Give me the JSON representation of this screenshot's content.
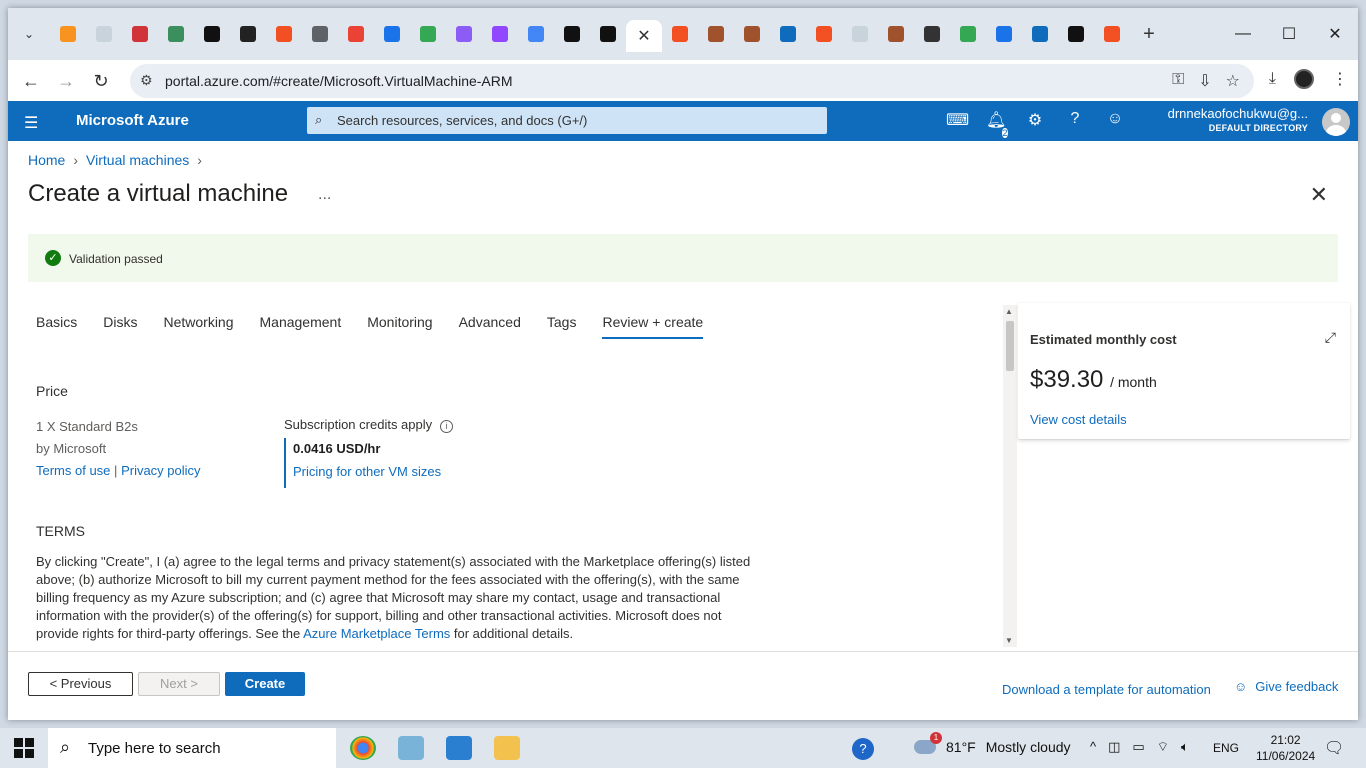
{
  "browser": {
    "url": "portal.azure.com/#create/Microsoft.VirtualMachine-ARM",
    "tab_favicons": [
      "#f7931e",
      "#c8d3dc",
      "#d13438",
      "#3a8f5c",
      "#111111",
      "#222222",
      "#f25022",
      "#5f6368",
      "#ea4335",
      "#1a73e8",
      "#34a853",
      "#8b5cf6",
      "#9146ff",
      "#4285f4",
      "#111111",
      "#111111",
      "#ffffff",
      "#f25022",
      "#a0522d",
      "#a0522d",
      "#0f6cbd",
      "#f25022",
      "#c8d3dc",
      "#a0522d",
      "#333333",
      "#34a853",
      "#1a73e8",
      "#0f6cbd",
      "#111111",
      "#f25022"
    ],
    "window_controls": {
      "minimize": "—",
      "maximize": "☐",
      "close": "✕"
    }
  },
  "azure": {
    "brand": "Microsoft Azure",
    "search_placeholder": "Search resources, services, and docs (G+/)",
    "notification_count": "2",
    "user_email": "drnnekaofochukwu@g...",
    "directory": "DEFAULT DIRECTORY"
  },
  "breadcrumb": {
    "home": "Home",
    "virtual_machines": "Virtual machines"
  },
  "page": {
    "title": "Create a virtual machine",
    "more": "...",
    "validation": "Validation passed"
  },
  "tabs": [
    "Basics",
    "Disks",
    "Networking",
    "Management",
    "Monitoring",
    "Advanced",
    "Tags",
    "Review + create"
  ],
  "price": {
    "heading": "Price",
    "sku": "1 X Standard B2s",
    "publisher": "by Microsoft",
    "terms_link": "Terms of use",
    "separator": "|",
    "privacy_link": "Privacy policy",
    "credits": "Subscription credits apply",
    "rate": "0.0416 USD/hr",
    "pricing_link": "Pricing for other VM sizes"
  },
  "terms": {
    "heading": "TERMS",
    "text_before": "By clicking \"Create\", I (a) agree to the legal terms and privacy statement(s) associated with the Marketplace offering(s) listed above; (b) authorize Microsoft to bill my current payment method for the fees associated with the offering(s), with the same billing frequency as my Azure subscription; and (c) agree that Microsoft may share my contact, usage and transactional information with the provider(s) of the offering(s) for support, billing and other transactional activities. Microsoft does not provide rights for third-party offerings. See the ",
    "link": "Azure Marketplace Terms",
    "text_after": " for additional details."
  },
  "cost": {
    "label": "Estimated monthly cost",
    "amount": "$39.30",
    "period": "/ month",
    "details_link": "View cost details"
  },
  "footer": {
    "previous": "< Previous",
    "next": "Next >",
    "create": "Create",
    "download": "Download a template for automation",
    "feedback": "Give feedback"
  },
  "taskbar": {
    "search_placeholder": "Type here to search",
    "weather_badge": "1",
    "temperature": "81°F",
    "condition": "Mostly cloudy",
    "language": "ENG",
    "time": "21:02",
    "date": "11/06/2024"
  }
}
